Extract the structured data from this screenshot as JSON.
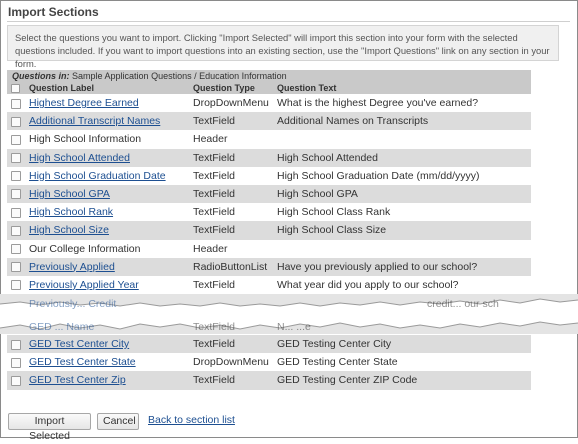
{
  "section_title": "Import Sections",
  "instructions": "Select the questions you want to import. Clicking \"Import Selected\" will import this section into your form with the selected questions included. If you want to import questions into an existing section, use the \"Import Questions\" link on any section in your form.",
  "table": {
    "questions_in_label": "Questions in:",
    "questions_in_value": " Sample Application Questions / Education Information",
    "columns": [
      "Question Label",
      "Question Type",
      "Question Text"
    ],
    "rows_top": [
      {
        "label": "Highest Degree Earned",
        "type": "DropDownMenu",
        "text": "What is the highest Degree you've earned?",
        "link": true
      },
      {
        "label": "Additional Transcript Names",
        "type": "TextField",
        "text": "Additional Names on Transcripts",
        "link": true
      },
      {
        "label": "High School Information",
        "type": "Header",
        "text": "",
        "link": false
      },
      {
        "label": "High School Attended",
        "type": "TextField",
        "text": "High School Attended",
        "link": true
      },
      {
        "label": "High School Graduation Date",
        "type": "TextField",
        "text": "High School Graduation Date (mm/dd/yyyy)",
        "link": true
      },
      {
        "label": "High School GPA",
        "type": "TextField",
        "text": "High School GPA",
        "link": true
      },
      {
        "label": "High School Rank",
        "type": "TextField",
        "text": "High School Class Rank",
        "link": true
      },
      {
        "label": "High School Size",
        "type": "TextField",
        "text": "High School Class Size",
        "link": true
      },
      {
        "label": "Our College Information",
        "type": "Header",
        "text": "",
        "link": false
      },
      {
        "label": "Previously Applied",
        "type": "RadioButtonList",
        "text": "Have you previously applied to our school?",
        "link": true
      },
      {
        "label": "Previously Applied Year",
        "type": "TextField",
        "text": "What year did you apply to our school?",
        "link": true
      }
    ],
    "torn_fragments": {
      "upper_left": "Previously... Credit",
      "upper_right": "credit... our sch",
      "lower_left": "GED ... Name",
      "lower_mid": "TextField",
      "lower_right": "N... ...e"
    },
    "rows_bottom": [
      {
        "label": "GED Test Center City",
        "type": "TextField",
        "text": "GED Testing Center City",
        "link": true
      },
      {
        "label": "GED Test Center State",
        "type": "DropDownMenu",
        "text": "GED Testing Center State",
        "link": true
      },
      {
        "label": "GED Test Center Zip",
        "type": "TextField",
        "text": "GED Testing Center ZIP Code",
        "link": true
      }
    ]
  },
  "buttons": {
    "import_selected": "Import Selected",
    "cancel": "Cancel",
    "back_link": "Back to section list"
  },
  "colors": {
    "link": "#1d4f91",
    "header_bg": "#c9c9c9",
    "row_alt_bg": "#dcdcdc",
    "instructions_bg": "#f0f0f0"
  }
}
